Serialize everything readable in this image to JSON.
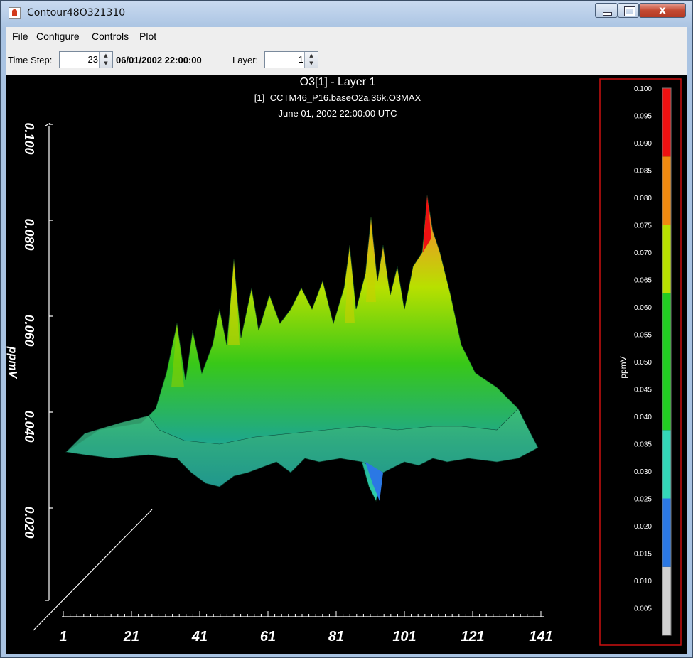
{
  "window": {
    "title": "Contour48O321310",
    "close_glyph": "x",
    "icons": [
      "java-app-icon",
      "minimize-icon",
      "maximize-icon",
      "close-icon"
    ]
  },
  "menu": {
    "file": "File",
    "configure": "Configure",
    "controls": "Controls",
    "plot": "Plot"
  },
  "toolbar": {
    "time_step_label": "Time Step:",
    "time_step_value": "23",
    "datetime": "06/01/2002 22:00:00",
    "layer_label": "Layer:",
    "layer_value": "1",
    "spin_up": "▲",
    "spin_down": "▼"
  },
  "plot": {
    "title": "O3[1] - Layer 1",
    "subtitle1": "[1]=CCTM46_P16.baseO2a.36k.O3MAX",
    "subtitle2": "June 01, 2002 22:00:00 UTC",
    "z_axis_label": "ppmV",
    "z_ticks": [
      "0.020",
      "0.040",
      "0.060",
      "0.080",
      "0.100"
    ],
    "x_ticks": [
      "1",
      "21",
      "41",
      "61",
      "81",
      "101",
      "121",
      "141"
    ],
    "background": "#000000"
  },
  "legend": {
    "unit": "ppmV",
    "border_color": "#cc1111",
    "ticks": [
      "0.100",
      "0.095",
      "0.090",
      "0.085",
      "0.080",
      "0.075",
      "0.070",
      "0.065",
      "0.060",
      "0.055",
      "0.050",
      "0.045",
      "0.040",
      "0.035",
      "0.030",
      "0.025",
      "0.020",
      "0.015",
      "0.010",
      "0.005"
    ],
    "bands": [
      {
        "from": 0.0,
        "to": 0.0125,
        "color": "#d0d0d0"
      },
      {
        "from": 0.0125,
        "to": 0.025,
        "color": "#2b78e4"
      },
      {
        "from": 0.025,
        "to": 0.0375,
        "color": "#33d6b8"
      },
      {
        "from": 0.0375,
        "to": 0.0625,
        "color": "#22cc22"
      },
      {
        "from": 0.0625,
        "to": 0.075,
        "color": "#b8e000"
      },
      {
        "from": 0.075,
        "to": 0.0875,
        "color": "#f08a10"
      },
      {
        "from": 0.0875,
        "to": 0.1,
        "color": "#ee1111"
      }
    ]
  }
}
